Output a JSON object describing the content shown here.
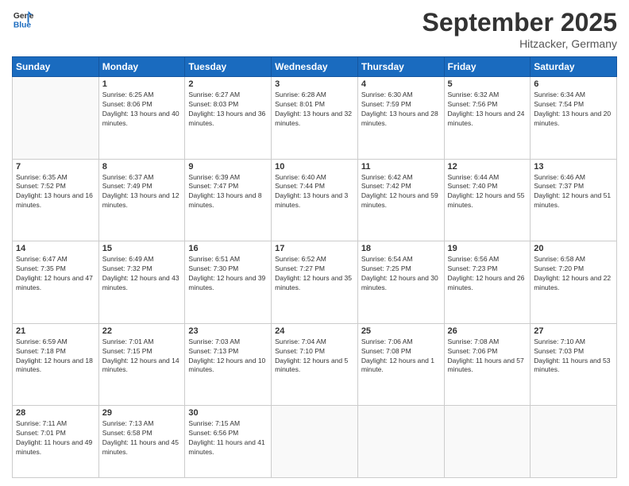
{
  "header": {
    "logo_line1": "General",
    "logo_line2": "Blue",
    "month": "September 2025",
    "location": "Hitzacker, Germany"
  },
  "days_of_week": [
    "Sunday",
    "Monday",
    "Tuesday",
    "Wednesday",
    "Thursday",
    "Friday",
    "Saturday"
  ],
  "weeks": [
    [
      {
        "num": "",
        "sunrise": "",
        "sunset": "",
        "daylight": ""
      },
      {
        "num": "1",
        "sunrise": "Sunrise: 6:25 AM",
        "sunset": "Sunset: 8:06 PM",
        "daylight": "Daylight: 13 hours and 40 minutes."
      },
      {
        "num": "2",
        "sunrise": "Sunrise: 6:27 AM",
        "sunset": "Sunset: 8:03 PM",
        "daylight": "Daylight: 13 hours and 36 minutes."
      },
      {
        "num": "3",
        "sunrise": "Sunrise: 6:28 AM",
        "sunset": "Sunset: 8:01 PM",
        "daylight": "Daylight: 13 hours and 32 minutes."
      },
      {
        "num": "4",
        "sunrise": "Sunrise: 6:30 AM",
        "sunset": "Sunset: 7:59 PM",
        "daylight": "Daylight: 13 hours and 28 minutes."
      },
      {
        "num": "5",
        "sunrise": "Sunrise: 6:32 AM",
        "sunset": "Sunset: 7:56 PM",
        "daylight": "Daylight: 13 hours and 24 minutes."
      },
      {
        "num": "6",
        "sunrise": "Sunrise: 6:34 AM",
        "sunset": "Sunset: 7:54 PM",
        "daylight": "Daylight: 13 hours and 20 minutes."
      }
    ],
    [
      {
        "num": "7",
        "sunrise": "Sunrise: 6:35 AM",
        "sunset": "Sunset: 7:52 PM",
        "daylight": "Daylight: 13 hours and 16 minutes."
      },
      {
        "num": "8",
        "sunrise": "Sunrise: 6:37 AM",
        "sunset": "Sunset: 7:49 PM",
        "daylight": "Daylight: 13 hours and 12 minutes."
      },
      {
        "num": "9",
        "sunrise": "Sunrise: 6:39 AM",
        "sunset": "Sunset: 7:47 PM",
        "daylight": "Daylight: 13 hours and 8 minutes."
      },
      {
        "num": "10",
        "sunrise": "Sunrise: 6:40 AM",
        "sunset": "Sunset: 7:44 PM",
        "daylight": "Daylight: 13 hours and 3 minutes."
      },
      {
        "num": "11",
        "sunrise": "Sunrise: 6:42 AM",
        "sunset": "Sunset: 7:42 PM",
        "daylight": "Daylight: 12 hours and 59 minutes."
      },
      {
        "num": "12",
        "sunrise": "Sunrise: 6:44 AM",
        "sunset": "Sunset: 7:40 PM",
        "daylight": "Daylight: 12 hours and 55 minutes."
      },
      {
        "num": "13",
        "sunrise": "Sunrise: 6:46 AM",
        "sunset": "Sunset: 7:37 PM",
        "daylight": "Daylight: 12 hours and 51 minutes."
      }
    ],
    [
      {
        "num": "14",
        "sunrise": "Sunrise: 6:47 AM",
        "sunset": "Sunset: 7:35 PM",
        "daylight": "Daylight: 12 hours and 47 minutes."
      },
      {
        "num": "15",
        "sunrise": "Sunrise: 6:49 AM",
        "sunset": "Sunset: 7:32 PM",
        "daylight": "Daylight: 12 hours and 43 minutes."
      },
      {
        "num": "16",
        "sunrise": "Sunrise: 6:51 AM",
        "sunset": "Sunset: 7:30 PM",
        "daylight": "Daylight: 12 hours and 39 minutes."
      },
      {
        "num": "17",
        "sunrise": "Sunrise: 6:52 AM",
        "sunset": "Sunset: 7:27 PM",
        "daylight": "Daylight: 12 hours and 35 minutes."
      },
      {
        "num": "18",
        "sunrise": "Sunrise: 6:54 AM",
        "sunset": "Sunset: 7:25 PM",
        "daylight": "Daylight: 12 hours and 30 minutes."
      },
      {
        "num": "19",
        "sunrise": "Sunrise: 6:56 AM",
        "sunset": "Sunset: 7:23 PM",
        "daylight": "Daylight: 12 hours and 26 minutes."
      },
      {
        "num": "20",
        "sunrise": "Sunrise: 6:58 AM",
        "sunset": "Sunset: 7:20 PM",
        "daylight": "Daylight: 12 hours and 22 minutes."
      }
    ],
    [
      {
        "num": "21",
        "sunrise": "Sunrise: 6:59 AM",
        "sunset": "Sunset: 7:18 PM",
        "daylight": "Daylight: 12 hours and 18 minutes."
      },
      {
        "num": "22",
        "sunrise": "Sunrise: 7:01 AM",
        "sunset": "Sunset: 7:15 PM",
        "daylight": "Daylight: 12 hours and 14 minutes."
      },
      {
        "num": "23",
        "sunrise": "Sunrise: 7:03 AM",
        "sunset": "Sunset: 7:13 PM",
        "daylight": "Daylight: 12 hours and 10 minutes."
      },
      {
        "num": "24",
        "sunrise": "Sunrise: 7:04 AM",
        "sunset": "Sunset: 7:10 PM",
        "daylight": "Daylight: 12 hours and 5 minutes."
      },
      {
        "num": "25",
        "sunrise": "Sunrise: 7:06 AM",
        "sunset": "Sunset: 7:08 PM",
        "daylight": "Daylight: 12 hours and 1 minute."
      },
      {
        "num": "26",
        "sunrise": "Sunrise: 7:08 AM",
        "sunset": "Sunset: 7:06 PM",
        "daylight": "Daylight: 11 hours and 57 minutes."
      },
      {
        "num": "27",
        "sunrise": "Sunrise: 7:10 AM",
        "sunset": "Sunset: 7:03 PM",
        "daylight": "Daylight: 11 hours and 53 minutes."
      }
    ],
    [
      {
        "num": "28",
        "sunrise": "Sunrise: 7:11 AM",
        "sunset": "Sunset: 7:01 PM",
        "daylight": "Daylight: 11 hours and 49 minutes."
      },
      {
        "num": "29",
        "sunrise": "Sunrise: 7:13 AM",
        "sunset": "Sunset: 6:58 PM",
        "daylight": "Daylight: 11 hours and 45 minutes."
      },
      {
        "num": "30",
        "sunrise": "Sunrise: 7:15 AM",
        "sunset": "Sunset: 6:56 PM",
        "daylight": "Daylight: 11 hours and 41 minutes."
      },
      {
        "num": "",
        "sunrise": "",
        "sunset": "",
        "daylight": ""
      },
      {
        "num": "",
        "sunrise": "",
        "sunset": "",
        "daylight": ""
      },
      {
        "num": "",
        "sunrise": "",
        "sunset": "",
        "daylight": ""
      },
      {
        "num": "",
        "sunrise": "",
        "sunset": "",
        "daylight": ""
      }
    ]
  ]
}
